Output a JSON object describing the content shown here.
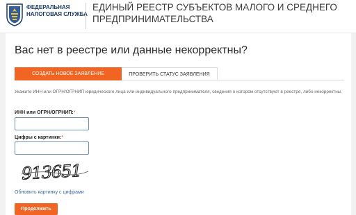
{
  "header": {
    "org_line1": "ФЕДЕРАЛЬНАЯ",
    "org_line2": "НАЛОГОВАЯ СЛУЖБА",
    "title_line1": "ЕДИНЫЙ РЕЕСТР СУБЪЕКТОВ МАЛОГО И СРЕДНЕГО",
    "title_line2": "ПРЕДПРИНИМАТЕЛЬСТВА",
    "logo_icon": "fns-emblem-icon"
  },
  "main": {
    "title": "Вас нет в реестре или данные некорректны?",
    "tabs": [
      {
        "label": "СОЗДАТЬ НОВОЕ ЗАЯВЛЕНИЕ",
        "active": true
      },
      {
        "label": "ПРОВЕРИТЬ СТАТУС ЗАЯВЛЕНИЯ",
        "active": false
      }
    ],
    "hint": "Укажите ИНН или ОГРН/ОГРНИП юридического лица или индивидуального предпринимателя, сведения о котором отсутствуют в реестре, либо некорректны.",
    "inn_label": "ИНН или ОГРН/ОГРНИП:",
    "inn_value": "",
    "captcha_label": "Цифры с картинки:",
    "captcha_value": "",
    "required_mark": "*",
    "captcha_text": "913651",
    "refresh_link": "Обновить картинку с цифрами",
    "submit_label": "Продолжить"
  },
  "colors": {
    "accent": "#f26422",
    "link": "#3f66a8",
    "required": "#e53935"
  }
}
